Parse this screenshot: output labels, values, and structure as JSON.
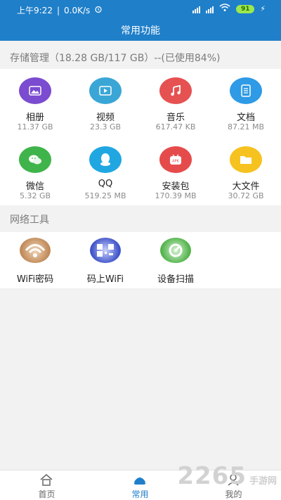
{
  "statusbar": {
    "time": "上午9:22",
    "speed": "0.0K/s",
    "battery": "91"
  },
  "header": {
    "title": "常用功能"
  },
  "storage": {
    "title": "存储管理（18.28 GB/117 GB）--(已使用84%)",
    "items": [
      {
        "label": "相册",
        "size": "11.37 GB",
        "icon": "photo-album-icon",
        "color": "#7b4bd0"
      },
      {
        "label": "视频",
        "size": "23.3 GB",
        "icon": "video-icon",
        "color": "#3aa6d6"
      },
      {
        "label": "音乐",
        "size": "617.47 KB",
        "icon": "music-icon",
        "color": "#e65151"
      },
      {
        "label": "文档",
        "size": "87.21 MB",
        "icon": "document-icon",
        "color": "#2f9ae6"
      },
      {
        "label": "微信",
        "size": "5.32 GB",
        "icon": "wechat-icon",
        "color": "#3fb44a"
      },
      {
        "label": "QQ",
        "size": "519.25 MB",
        "icon": "qq-icon",
        "color": "#20a7e2"
      },
      {
        "label": "安装包",
        "size": "170.39 MB",
        "icon": "apk-icon",
        "color": "#e64b4b"
      },
      {
        "label": "大文件",
        "size": "30.72 GB",
        "icon": "folder-icon",
        "color": "#f6c21f"
      }
    ]
  },
  "network": {
    "title": "网络工具",
    "items": [
      {
        "label": "WiFi密码",
        "icon": "wifi-password-icon",
        "color": "#c08a59"
      },
      {
        "label": "码上WiFi",
        "icon": "qr-wifi-icon",
        "color": "#3f53c8"
      },
      {
        "label": "设备扫描",
        "icon": "device-scan-icon",
        "color": "#52b34b"
      }
    ]
  },
  "bottom_nav": [
    {
      "label": "首页",
      "icon": "home-icon",
      "active": false
    },
    {
      "label": "常用",
      "icon": "common-icon",
      "active": true
    },
    {
      "label": "我的",
      "icon": "profile-icon",
      "active": false
    }
  ],
  "watermark": {
    "number": "2265",
    "text": "手游网"
  }
}
